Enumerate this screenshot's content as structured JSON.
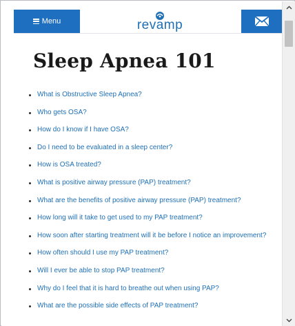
{
  "header": {
    "menu_label": "Menu",
    "logo_text": "revamp",
    "brand_color": "#1f6fc0",
    "menu_icon": "hamburger-icon",
    "mail_icon": "envelope-icon"
  },
  "main": {
    "title": "Sleep Apnea 101",
    "links": [
      "What is Obstructive Sleep Apnea?",
      "Who gets OSA?",
      "How do I know if I have OSA?",
      "Do I need to be evaluated in a sleep center?",
      "How is OSA treated?",
      "What is positive airway pressure (PAP) treatment?",
      "What are the benefits of positive airway pressure (PAP) treatment?",
      "How long will it take to get used to my PAP treatment?",
      "How soon after starting treatment will it be before I notice an improvement?",
      "How often should I use my PAP treatment?",
      "Will I ever be able to stop PAP treatment?",
      "Why do I feel that it is hard to breathe out when using PAP?",
      "What are the possible side effects of PAP treatment?"
    ],
    "link_color": "#1e6fb5"
  },
  "scrollbar": {
    "up_icon": "chevron-up-icon",
    "down_icon": "chevron-down-icon"
  }
}
